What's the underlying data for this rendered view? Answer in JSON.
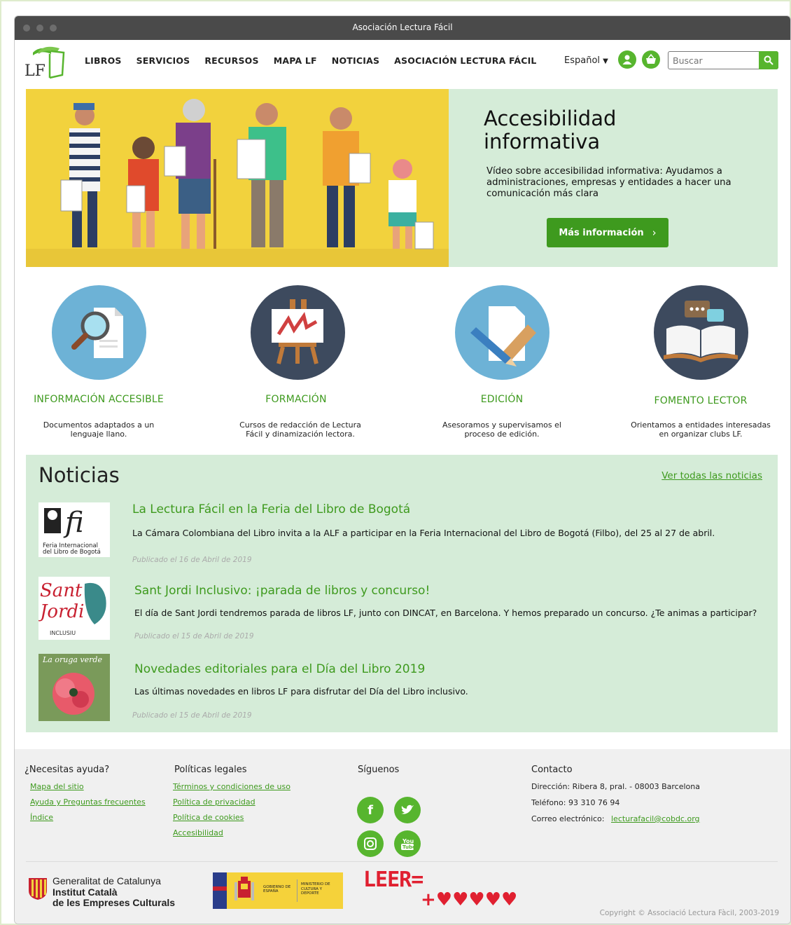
{
  "window": {
    "title": "Asociación Lectura Fácil"
  },
  "header": {
    "logo_text": "LF",
    "nav": [
      "LIBROS",
      "SERVICIOS",
      "RECURSOS",
      "MAPA LF",
      "NOTICIAS",
      "ASOCIACIÓN LECTURA FÁCIL"
    ],
    "language": "Español",
    "search_placeholder": "Buscar"
  },
  "hero": {
    "title": "Accesibilidad informativa",
    "text": "Vídeo sobre accesibilidad informativa: Ayudamos a administraciones, empresas y entidades a hacer una comunicación más clara",
    "button": "Más información"
  },
  "services": [
    {
      "name": "INFORMACIÓN ACCESIBLE",
      "desc": "Documentos adaptados a un lenguaje llano.",
      "icon": "magnifier-document-icon"
    },
    {
      "name": "FORMACIÓN",
      "desc": "Cursos de redacción de Lectura Fácil y dinamización lectora.",
      "icon": "easel-icon"
    },
    {
      "name": "EDICIÓN",
      "desc": "Asesoramos y supervisamos el proceso de edición.",
      "icon": "pencil-ruler-icon"
    },
    {
      "name": "FOMENTO LECTOR",
      "desc": "Orientamos a entidades interesadas en organizar clubs LF.",
      "icon": "open-book-icon"
    }
  ],
  "news": {
    "title": "Noticias",
    "view_all": "Ver todas las noticias",
    "items": [
      {
        "title": "La Lectura Fácil en la Feria del Libro de Bogotá",
        "text": "La Cámara Colombiana del Libro invita a la ALF a participar en la Feria Internacional del Libro de Bogotá (Filbo), del 25 al 27 de abril.",
        "date": "Publicado el 16 de Abril de 2019",
        "thumb_caption": "Feria Internacional del Libro de Bogotá"
      },
      {
        "title": "Sant Jordi Inclusivo: ¡parada de libros y concurso!",
        "text": "El día de Sant Jordi tendremos parada de libros LF, junto con DINCAT, en Barcelona. Y hemos preparado un concurso. ¿Te animas a participar?",
        "date": "Publicado el 15 de Abril de 2019",
        "thumb_caption": "INCLUSIU"
      },
      {
        "title": "Novedades editoriales para el Día del Libro 2019",
        "text": "Las últimas novedades en libros LF para disfrutar del Día del Libro inclusivo.",
        "date": "Publicado el 15 de Abril de 2019",
        "thumb_caption": "La oruga verde"
      }
    ]
  },
  "footer": {
    "help": {
      "title": "¿Necesitas ayuda?",
      "links": [
        "Mapa del sitio",
        "Ayuda y Preguntas frecuentes",
        "Índice"
      ]
    },
    "legal": {
      "title": "Políticas legales",
      "links": [
        "Términos y condiciones de uso",
        "Política de privacidad",
        "Política de cookies",
        "Accesibilidad"
      ]
    },
    "social": {
      "title": "Síguenos",
      "icons": [
        "facebook-icon",
        "twitter-icon",
        "instagram-icon",
        "youtube-icon"
      ]
    },
    "contact": {
      "title": "Contacto",
      "address": "Dirección: Ribera 8, pral. - 08003 Barcelona",
      "phone": "Teléfono: 93 310 76 94",
      "email_label": "Correo electrónico:",
      "email": "lecturafacil@cobdc.org"
    },
    "sponsors": {
      "gencat_line1": "Generalitat de Catalunya",
      "gencat_line2": "Institut Català",
      "gencat_line3": "de les Empreses Culturals",
      "gobierno": "GOBIERNO DE ESPAÑA",
      "ministerio": "MINISTERIO DE CULTURA Y DEPORTE",
      "leer_line1": "LEER=",
      "leer_line2": "+♥♥♥♥♥"
    },
    "copyright": "Copyright © Associació Lectura Fàcil, 2003-2019"
  },
  "colors": {
    "green": "#57b52e",
    "dark_green": "#3e9a1e",
    "mint": "#d5ecd8",
    "yellow": "#f2d23d",
    "footer_bg": "#f0f0f0"
  }
}
